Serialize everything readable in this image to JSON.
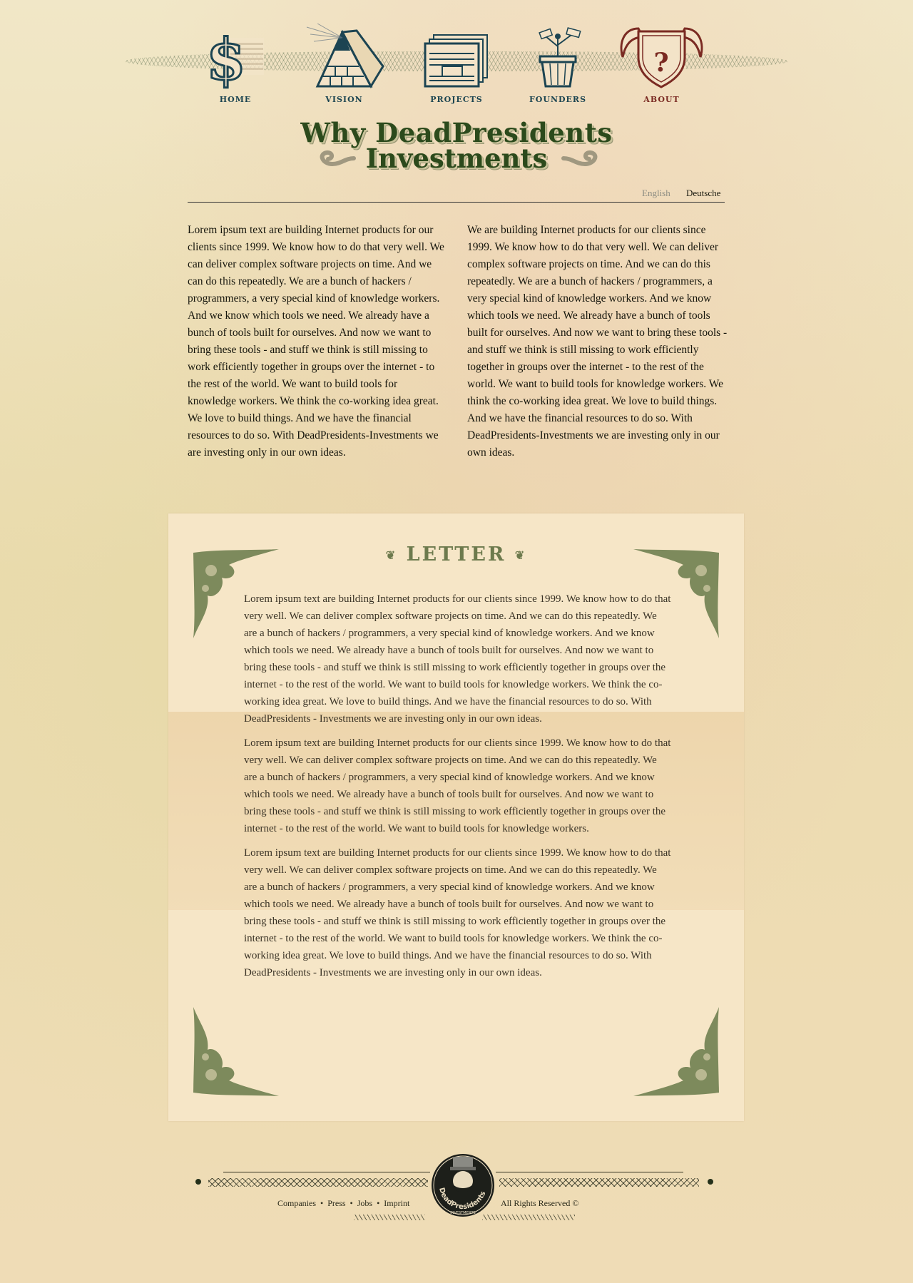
{
  "nav": {
    "items": [
      {
        "label": "HOME",
        "icon": "dollar-sign-icon"
      },
      {
        "label": "VISION",
        "icon": "pyramid-eye-icon"
      },
      {
        "label": "PROJECTS",
        "icon": "stacked-bills-icon"
      },
      {
        "label": "FOUNDERS",
        "icon": "money-plant-icon"
      },
      {
        "label": "ABOUT",
        "icon": "winged-question-shield-icon"
      }
    ],
    "active": "ABOUT"
  },
  "headline": {
    "line1": "Why DeadPresidents",
    "line2": "Investments"
  },
  "languages": {
    "english": "English",
    "deutsche": "Deutsche",
    "selected": "Deutsche"
  },
  "intro": {
    "left": "Lorem ipsum text are building Internet products for our clients since 1999. We know how to do that very well. We can deliver complex software projects on time. And we can do this repeatedly. We are a bunch of hackers / programmers, a very special kind of knowledge workers. And we know which tools we need. We already have a bunch of tools built for ourselves. And now we want to bring these tools - and stuff we think is still missing to work efficiently together in groups over the internet - to the rest of the world. We want to build tools for knowledge workers. We think the co-working idea great. We love to build things. And we have the financial resources to do so. With DeadPresidents-Investments we are investing only in our own ideas.",
    "right": "We are building Internet products for our clients since 1999. We know how to do that very well. We can deliver complex software projects on time. And we can do this repeatedly. We are a bunch of hackers / programmers, a very special kind of knowledge workers. And we know which tools we need. We already have a bunch of tools built for ourselves. And now we want to bring these tools - and stuff we think is still missing to work efficiently together in groups over the internet - to the rest of the world. We want to build tools for knowledge workers. We think the co-working idea great. We love to build things. And we have the financial resources to do so. With DeadPresidents-Investments we are investing only in our own ideas."
  },
  "letter": {
    "title": "LETTER",
    "paragraphs": [
      "Lorem ipsum text are building Internet products for our clients since 1999. We know how to do that very well. We can deliver complex software projects on time. And we can do this repeatedly. We are a bunch of hackers / programmers, a very special kind of knowledge workers. And we know which tools we need. We already have a bunch of tools built for ourselves. And now we want to bring these tools - and stuff we think is still missing to work efficiently together in groups over the internet - to the rest of the world. We want to build tools for knowledge workers. We think the co-working idea great. We love to build things. And we have the financial resources to do so. With DeadPresidents - Investments we are investing only in our own ideas.",
      "Lorem ipsum text are building Internet products for our clients since 1999. We know how to do that very well. We can deliver complex software projects on time. And we can do this repeatedly. We are a bunch of hackers / programmers, a very special kind of knowledge workers. And we know which tools we need. We already have a bunch of tools built for ourselves. And now we want to bring these tools - and stuff we think is still missing to work efficiently together in groups over the internet - to the rest of the world. We want to build tools for knowledge workers.",
      "Lorem ipsum text are building Internet products for our clients since 1999. We know how to do that very well. We can deliver complex software projects on time. And we can do this repeatedly. We are a bunch of hackers / programmers, a very special kind of knowledge workers. And we know which tools we need. We already have a bunch of tools built for ourselves. And now we want to bring these tools - and stuff we think is still missing to work efficiently together in groups over the internet - to the rest of the world. We want to build tools for knowledge workers. We think the co-working idea great. We love to build things. And we have the financial resources to do so. With DeadPresidents - Investments we are investing only in our own ideas."
    ]
  },
  "footer": {
    "links": [
      "Companies",
      "Press",
      "Jobs",
      "Imprint"
    ],
    "separator": "•",
    "copyright": "All Rights Reserved ©",
    "seal_text": "DeadPresidents",
    "seal_subtext": "INVESTMENTS"
  },
  "colors": {
    "nav_label": "#1b4450",
    "nav_active": "#7a2a22",
    "headline": "#2c4a1c",
    "ornament": "#6d7a4d",
    "paper": "#f6e6c7"
  }
}
